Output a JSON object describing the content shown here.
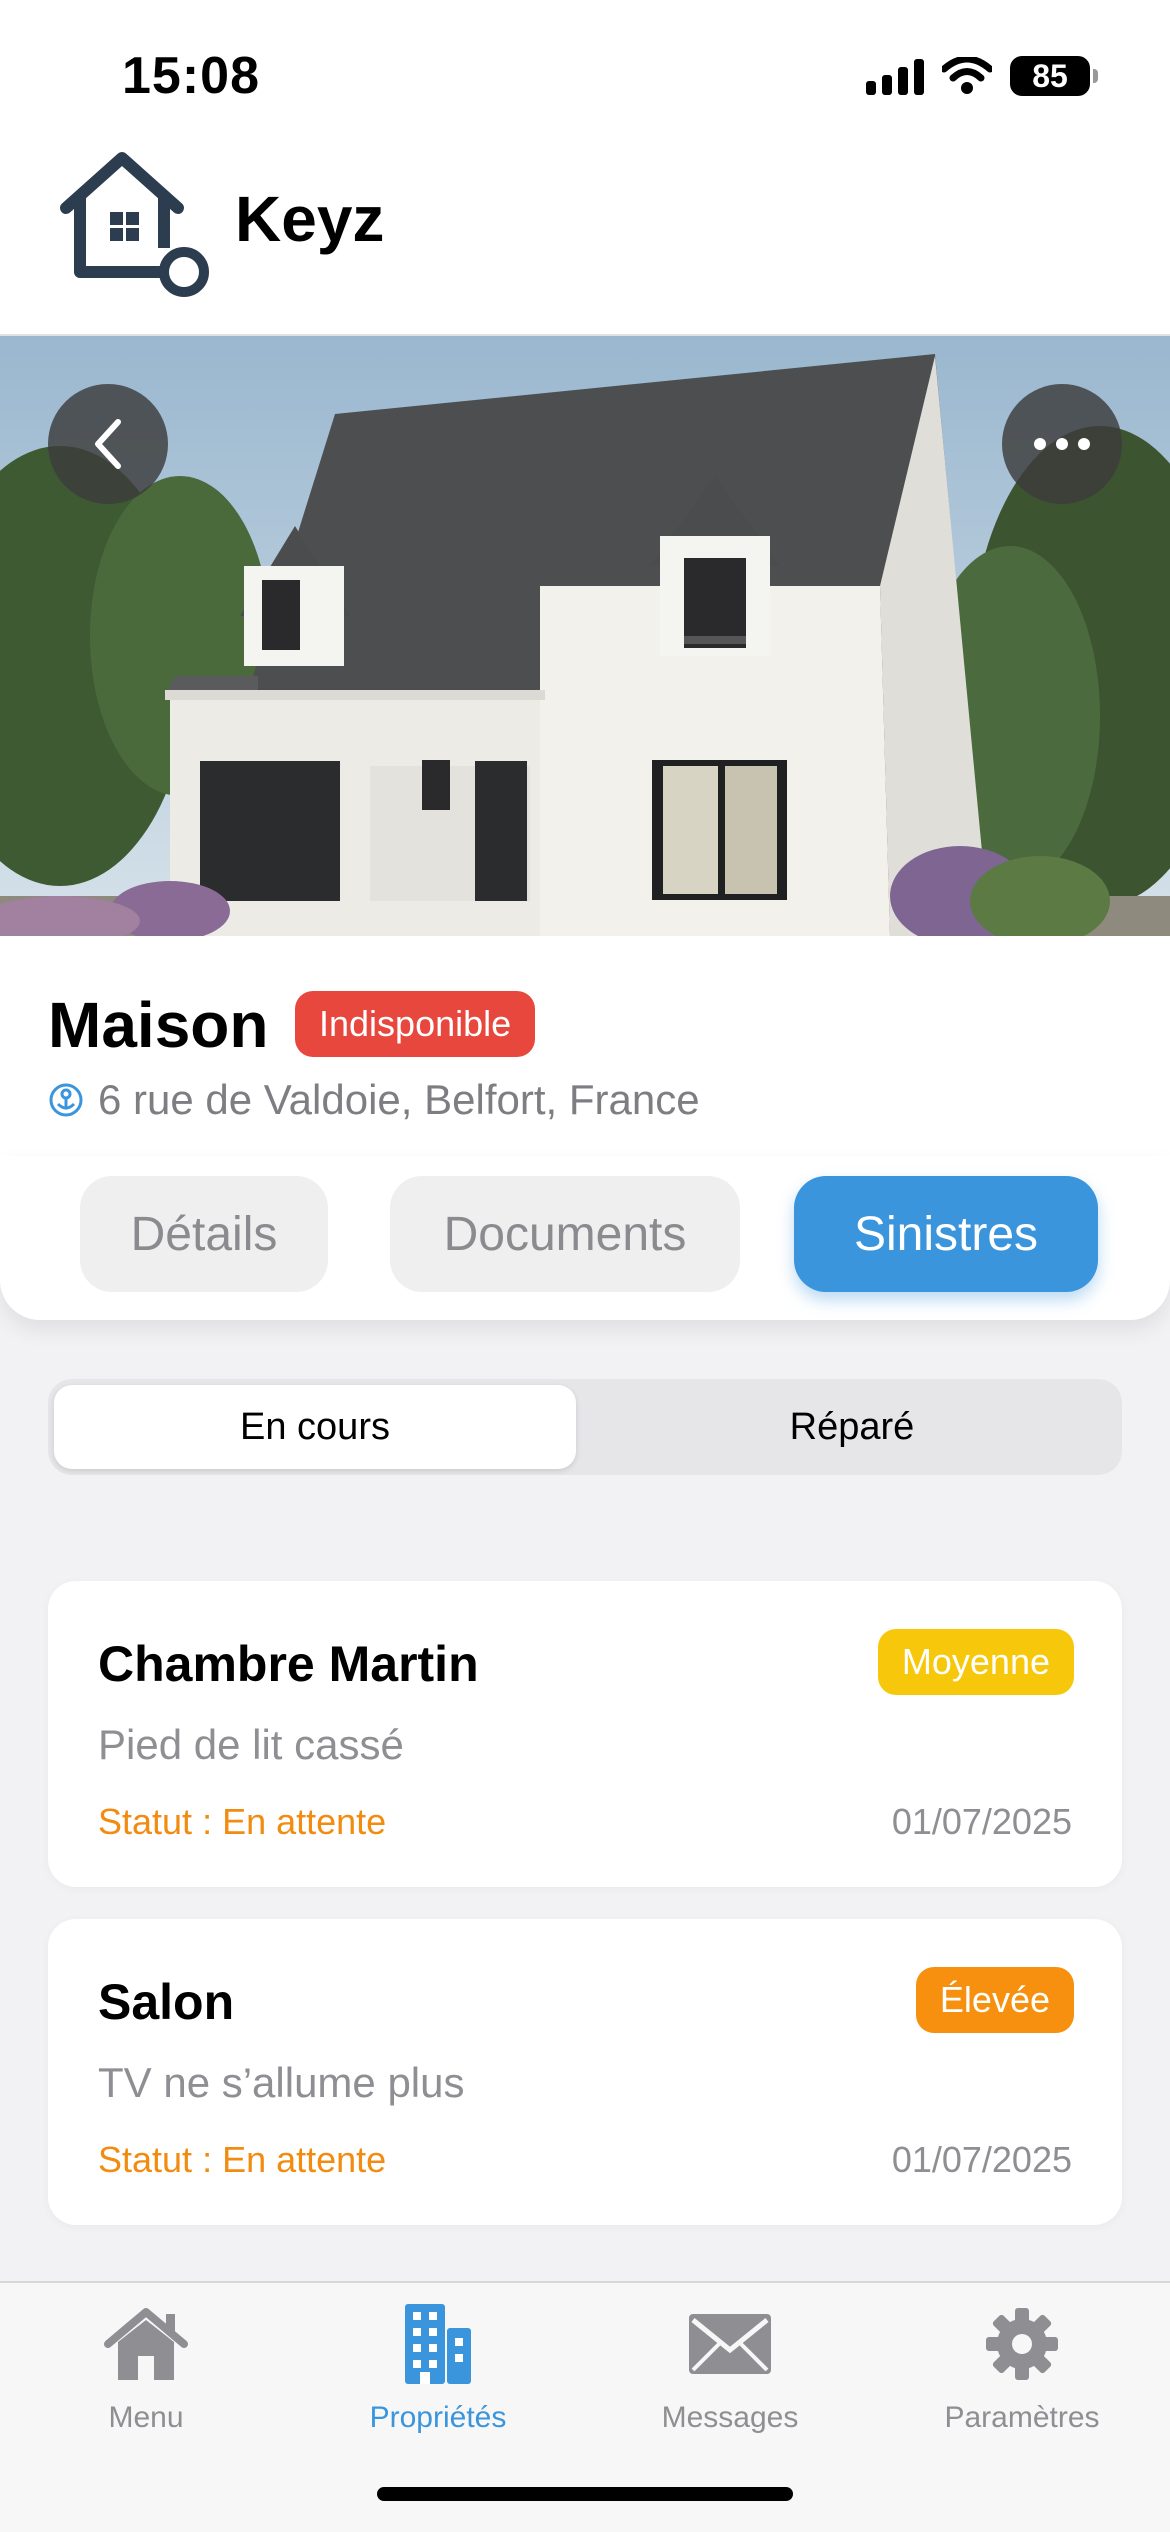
{
  "status_bar": {
    "time": "15:08",
    "battery": "85"
  },
  "header": {
    "brand": "Keyz"
  },
  "hero": {
    "back_icon": "chevron-left-icon",
    "more_icon": "ellipsis-icon"
  },
  "property": {
    "title": "Maison",
    "status_badge": "Indisponible",
    "address": "6 rue de Valdoie, Belfort, France"
  },
  "tabs": [
    {
      "label": "Détails",
      "active": false
    },
    {
      "label": "Documents",
      "active": false
    },
    {
      "label": "Sinistres",
      "active": true
    }
  ],
  "segment": {
    "left": "En cours",
    "right": "Réparé",
    "selected": "En cours"
  },
  "damages": [
    {
      "title": "Chambre Martin",
      "priority": "Moyenne",
      "priority_color": "#f7c70c",
      "description": "Pied de lit cassé",
      "status": "Statut : En attente",
      "date": "01/07/2025"
    },
    {
      "title": "Salon",
      "priority": "Élevée",
      "priority_color": "#f6900e",
      "description": "TV ne s’allume plus",
      "status": "Statut : En attente",
      "date": "01/07/2025"
    }
  ],
  "tab_bar": [
    {
      "label": "Menu",
      "icon": "home-icon",
      "active": false
    },
    {
      "label": "Propriétés",
      "icon": "building-icon",
      "active": true
    },
    {
      "label": "Messages",
      "icon": "envelope-icon",
      "active": false
    },
    {
      "label": "Paramètres",
      "icon": "gear-icon",
      "active": false
    }
  ],
  "colors": {
    "accent": "#3b95dc",
    "danger": "#e8473d",
    "warning": "#f28c10"
  }
}
